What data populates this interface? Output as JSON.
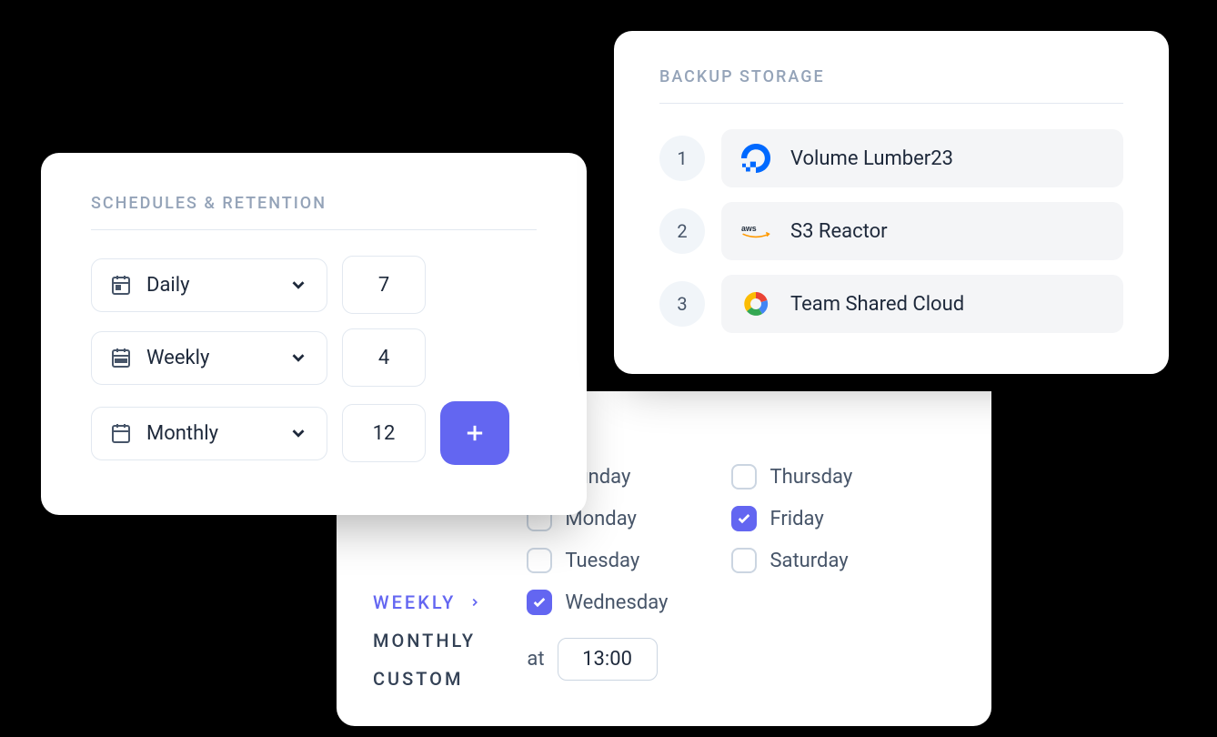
{
  "schedules": {
    "title": "SCHEDULES & RETENTION",
    "rows": [
      {
        "label": "Daily",
        "value": "7"
      },
      {
        "label": "Weekly",
        "value": "4"
      },
      {
        "label": "Monthly",
        "value": "12"
      }
    ]
  },
  "storage": {
    "title": "BACKUP STORAGE",
    "items": [
      {
        "num": "1",
        "name": "Volume Lumber23",
        "icon": "digitalocean"
      },
      {
        "num": "2",
        "name": "S3 Reactor",
        "icon": "aws"
      },
      {
        "num": "3",
        "name": "Team Shared Cloud",
        "icon": "gcloud"
      }
    ]
  },
  "frequency": {
    "options": [
      {
        "label": "WEEKLY",
        "active": true
      },
      {
        "label": "MONTHLY",
        "active": false
      },
      {
        "label": "CUSTOM",
        "active": false
      }
    ],
    "days": [
      {
        "label": "Sunday",
        "checked": false
      },
      {
        "label": "Thursday",
        "checked": false
      },
      {
        "label": "Monday",
        "checked": false
      },
      {
        "label": "Friday",
        "checked": true
      },
      {
        "label": "Tuesday",
        "checked": false
      },
      {
        "label": "Saturday",
        "checked": false
      },
      {
        "label": "Wednesday",
        "checked": true
      }
    ],
    "at_label": "at",
    "time": "13:00"
  },
  "colors": {
    "accent": "#6366f1",
    "muted": "#94a3b8"
  }
}
